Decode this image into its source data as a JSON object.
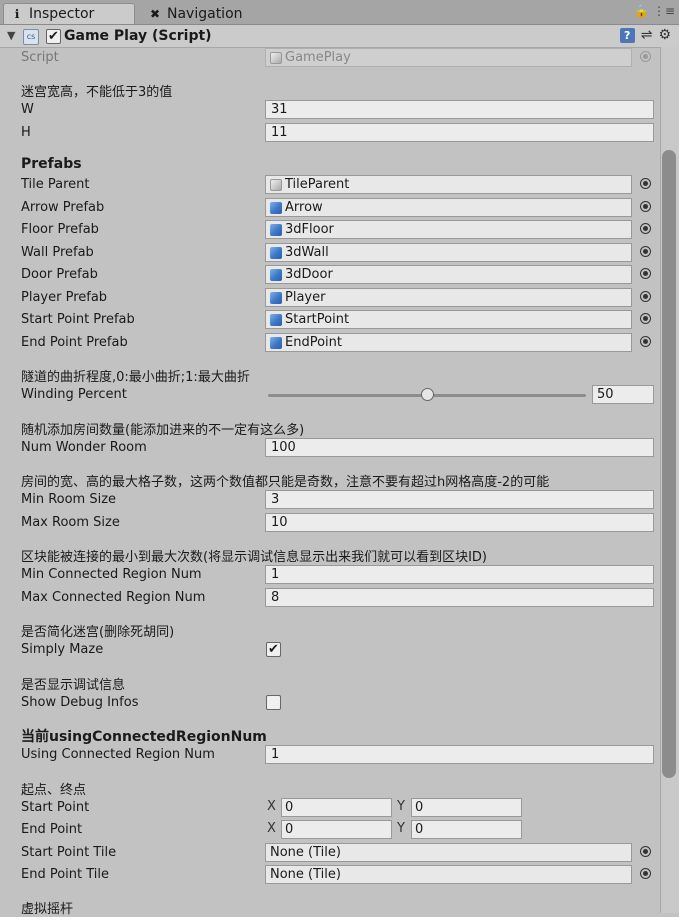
{
  "tabs": {
    "inspector": "Inspector",
    "navigation": "Navigation"
  },
  "component": {
    "title": "Game Play (Script)",
    "enabled": true
  },
  "script": {
    "label": "Script",
    "value": "GamePlay"
  },
  "maze_size": {
    "header": "迷宫宽高，不能低于3的值",
    "w_label": "W",
    "w_value": "31",
    "h_label": "H",
    "h_value": "11"
  },
  "prefabs": {
    "header": "Prefabs",
    "items": [
      {
        "label": "Tile Parent",
        "value": "TileParent"
      },
      {
        "label": "Arrow Prefab",
        "value": "Arrow"
      },
      {
        "label": "Floor Prefab",
        "value": "3dFloor"
      },
      {
        "label": "Wall Prefab",
        "value": "3dWall"
      },
      {
        "label": "Door Prefab",
        "value": "3dDoor"
      },
      {
        "label": "Player Prefab",
        "value": "Player"
      },
      {
        "label": "Start Point Prefab",
        "value": "StartPoint"
      },
      {
        "label": "End Point Prefab",
        "value": "EndPoint"
      }
    ]
  },
  "winding": {
    "header": "隧道的曲折程度,0:最小曲折;1:最大曲折",
    "label": "Winding Percent",
    "value": "50",
    "fraction": 0.5
  },
  "rooms": {
    "header": "随机添加房间数量(能添加进来的不一定有这么多)",
    "label": "Num Wonder Room",
    "value": "100"
  },
  "room_size": {
    "header": "房间的宽、高的最大格子数，这两个数值都只能是奇数，注意不要有超过h网格高度-2的可能",
    "min_label": "Min Room Size",
    "min_value": "3",
    "max_label": "Max Room Size",
    "max_value": "10"
  },
  "regions": {
    "header": "区块能被连接的最小到最大次数(将显示调试信息显示出来我们就可以看到区块ID)",
    "min_label": "Min Connected Region Num",
    "min_value": "1",
    "max_label": "Max Connected Region Num",
    "max_value": "8"
  },
  "simplify": {
    "header": "是否简化迷宫(删除死胡同)",
    "label": "Simply Maze",
    "checked": true
  },
  "debug": {
    "header": "是否显示调试信息",
    "label": "Show Debug Infos",
    "checked": false
  },
  "using_region": {
    "header": "当前usingConnectedRegionNum",
    "label": "Using Connected Region Num",
    "value": "1"
  },
  "points": {
    "header": "起点、终点",
    "x_label": "X",
    "y_label": "Y",
    "start_label": "Start Point",
    "start_x": "0",
    "start_y": "0",
    "end_label": "End Point",
    "end_x": "0",
    "end_y": "0",
    "start_tile_label": "Start Point Tile",
    "start_tile_value": "None (Tile)",
    "end_tile_label": "End Point Tile",
    "end_tile_value": "None (Tile)"
  },
  "joystick": {
    "header": "虚拟摇杆"
  },
  "icons": {
    "inspector_tab": "info-icon",
    "navigation_tab": "navigation-icon",
    "lock": "lock-icon",
    "menu": "menu-icon",
    "help": "help-icon",
    "presets": "presets-icon",
    "settings": "gear-icon"
  }
}
